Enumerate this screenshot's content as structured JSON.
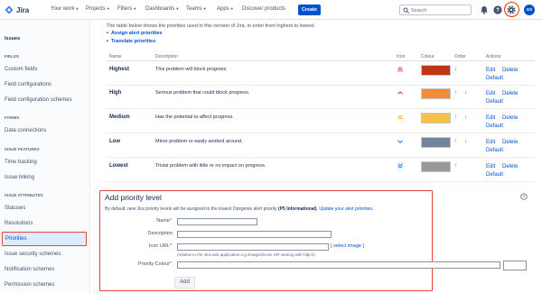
{
  "header": {
    "app_name": "Jira",
    "nav": [
      {
        "label": "Your work"
      },
      {
        "label": "Projects"
      },
      {
        "label": "Filters"
      },
      {
        "label": "Dashboards"
      },
      {
        "label": "Teams"
      },
      {
        "label": "Apps"
      },
      {
        "label": "Discover products"
      }
    ],
    "create_label": "Create",
    "search_placeholder": "Search",
    "avatar_initials": "GS",
    "icons": [
      "notifications-icon",
      "help-icon",
      "settings-icon"
    ]
  },
  "sidebar": {
    "title": "Issues",
    "sections": [
      {
        "title": "FIELDS",
        "items": [
          "Custom fields",
          "Field configurations",
          "Field configuration schemes"
        ]
      },
      {
        "title": "FORMS",
        "items": [
          "Data connections"
        ]
      },
      {
        "title": "ISSUE FEATURES",
        "items": [
          "Time tracking",
          "Issue linking"
        ]
      },
      {
        "title": "ISSUE ATTRIBUTES",
        "items": [
          "Statuses",
          "Resolutions",
          "Priorities",
          "Issue security schemes",
          "Notification schemes",
          "Permission schemes"
        ]
      }
    ],
    "active_item": "Priorities"
  },
  "main": {
    "intro": "The table below shows the priorities used in this version of Jira, in order from highest to lowest.",
    "links": [
      "Assign alert priorities",
      "Translate priorities"
    ],
    "columns": [
      "Name",
      "Description",
      "Icon",
      "Colour",
      "Order",
      "Actions"
    ],
    "priorities": [
      {
        "name": "Highest",
        "description": "This problem will block progress.",
        "color": "#c03619",
        "order": "↓",
        "icon": "chevron-double-up-icon"
      },
      {
        "name": "High",
        "description": "Serious problem that could block progress.",
        "color": "#f58b36",
        "order": "↑ ↓",
        "icon": "chevron-up-icon"
      },
      {
        "name": "Medium",
        "description": "Has the potential to affect progress.",
        "color": "#f7c244",
        "order": "↑ ↓",
        "icon": "equals-icon"
      },
      {
        "name": "Low",
        "description": "Minor problem or easily worked around.",
        "color": "#74829a",
        "order": "↑ ↓",
        "icon": "chevron-down-icon"
      },
      {
        "name": "Lowest",
        "description": "Trivial problem with little or no impact on progress.",
        "color": "#999999",
        "order": "↑",
        "icon": "chevron-double-down-icon"
      }
    ],
    "actions": {
      "edit": "Edit",
      "delete": "Delete",
      "default": "Default"
    }
  },
  "add_form": {
    "title": "Add priority level",
    "desc_prefix": "By default, new Jira priority levels will be assigned to the lowest Opsgenie alert priority",
    "desc_bold": "(P5 Informational)",
    "desc_link": "Update your alert priorities.",
    "name_label": "Name",
    "description_label": "Description",
    "icon_label": "Icon URL",
    "select_image": "select image",
    "icon_hint": "(relative to the Jira web application e.g /images/icons OR starting with http://)",
    "color_label": "Priority Colour",
    "required_mark": "*",
    "add_button": "Add",
    "colors": {
      "required": "#de350b",
      "link": "#0052cc",
      "highlight": "#e34935"
    }
  }
}
